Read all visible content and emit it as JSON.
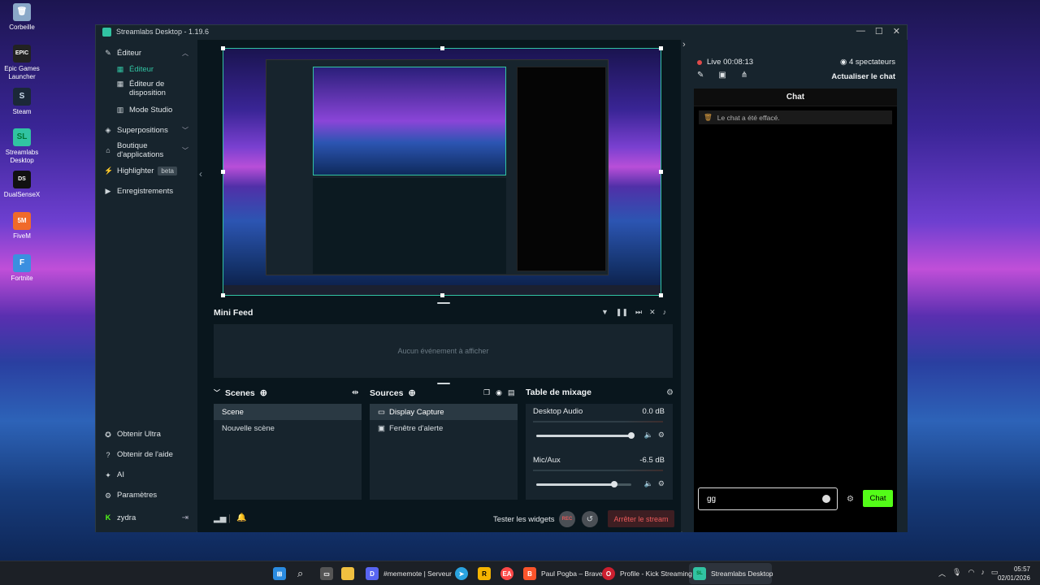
{
  "desktop": {
    "icons": [
      {
        "label": "Corbeille",
        "glyph": "🗑",
        "color": "#8aa8c8"
      },
      {
        "label": "Epic Games Launcher",
        "glyph": "EPIC",
        "color": "#222222"
      },
      {
        "label": "Steam",
        "glyph": "S",
        "color": "#1b2838"
      },
      {
        "label": "Streamlabs Desktop",
        "glyph": "SL",
        "color": "#31c3a2"
      },
      {
        "label": "DualSenseX",
        "glyph": "DS",
        "color": "#111111"
      },
      {
        "label": "FiveM",
        "glyph": "5M",
        "color": "#f06a2a"
      },
      {
        "label": "Fortnite",
        "glyph": "F",
        "color": "#3b8fe0"
      }
    ]
  },
  "window": {
    "title": "Streamlabs Desktop - 1.19.6",
    "controls": [
      "—",
      "☐",
      "✕"
    ]
  },
  "sidebar": {
    "editor": "Éditeur",
    "editor_active": "Éditeur",
    "layout_editor": "Éditeur de disposition",
    "studio_mode": "Mode Studio",
    "overlays": "Superpositions",
    "app_store": "Boutique d'applications",
    "highlighter": "Highlighter",
    "beta": "beta",
    "recordings": "Enregistrements",
    "ultra": "Obtenir Ultra",
    "help": "Obtenir de l'aide",
    "ai": "AI",
    "settings": "Paramètres",
    "user": "zydra"
  },
  "minifeed": {
    "title": "Mini Feed",
    "empty": "Aucun événement à afficher"
  },
  "scenes": {
    "title": "Scenes",
    "items": [
      "Scene",
      "Nouvelle scène"
    ]
  },
  "sources": {
    "title": "Sources",
    "items": [
      "Display Capture",
      "Fenêtre d'alerte"
    ]
  },
  "mixer": {
    "title": "Table de mixage",
    "channels": [
      {
        "name": "Desktop Audio",
        "db": "0.0 dB",
        "level": 1.0
      },
      {
        "name": "Mic/Aux",
        "db": "-6.5 dB",
        "level": 0.82
      }
    ]
  },
  "bottombar": {
    "test_widgets": "Tester les widgets",
    "rec": "REC",
    "stop_stream": "Arrêter le stream"
  },
  "chatpanel": {
    "live": "Live 00:08:13",
    "viewers": "4 spectateurs",
    "refresh": "Actualiser le chat",
    "chat_title": "Chat",
    "cleared_msg": "Le chat a été effacé.",
    "input_value": "gg",
    "send": "Chat"
  },
  "taskbar": {
    "items": [
      {
        "label": "#mememote | Serveur",
        "color": "#5865f2",
        "glyph": "D"
      },
      {
        "label": "Paul Pogba – Brave",
        "color": "#fb542b",
        "glyph": "B"
      },
      {
        "label": "Profile - Kick Streaming",
        "color": "#cc1f2f",
        "glyph": "O"
      },
      {
        "label": "Streamlabs Desktop",
        "color": "#31c3a2",
        "glyph": "SL"
      }
    ],
    "time": "05:57",
    "date": "02/01/2026"
  }
}
